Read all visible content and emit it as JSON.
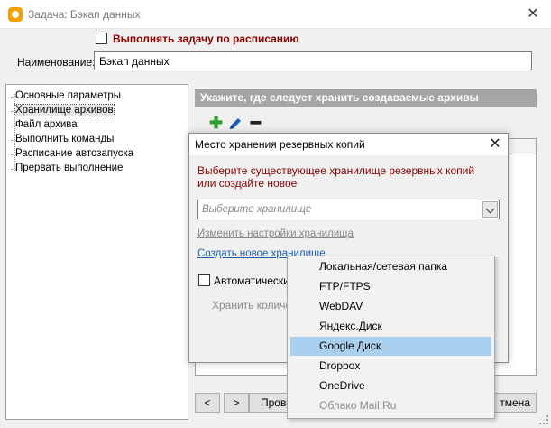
{
  "window": {
    "title": "Задача: Бэкап данных"
  },
  "schedule": {
    "label": "Выполнять задачу по расписанию",
    "checked": false
  },
  "name_field": {
    "label": "Наименование:",
    "value": "Бэкап данных"
  },
  "tree": {
    "items": [
      {
        "label": "Основные параметры"
      },
      {
        "label": "Хранилище архивов",
        "selected": true
      },
      {
        "label": "Файл архива"
      },
      {
        "label": "Выполнить команды"
      },
      {
        "label": "Расписание автозапуска"
      },
      {
        "label": "Прервать выполнение"
      }
    ]
  },
  "panel": {
    "header": "Укажите, где следует хранить создаваемые архивы",
    "toolbar": {
      "add_icon": "plus-icon",
      "edit_icon": "pencil-icon",
      "remove_icon": "minus-icon"
    }
  },
  "footer": {
    "prev_label": "<",
    "next_label": ">",
    "check_label": "Прове",
    "cancel_label": "тмена"
  },
  "dialog": {
    "title": "Место хранения резервных копий",
    "prompt": "Выберите существующее хранилище резервных копий или создайте новое",
    "combo_placeholder": "Выберите хранилище",
    "edit_link": "Изменить настройки хранилища",
    "create_link": "Создать новое хранилище",
    "auto_label": "Автоматически у",
    "keep_label": "Хранить количе"
  },
  "menu": {
    "items": [
      {
        "label": "Локальная/сетевая папка"
      },
      {
        "label": "FTP/FTPS"
      },
      {
        "label": "WebDAV"
      },
      {
        "label": "Яндекс.Диск"
      },
      {
        "label": "Google Диск",
        "highlighted": true
      },
      {
        "label": "Dropbox"
      },
      {
        "label": "OneDrive"
      },
      {
        "label": "Облако Mail.Ru",
        "disabled": true
      }
    ]
  },
  "colors": {
    "accent_red": "#8b0000",
    "link_blue": "#1a5fb4",
    "highlight": "#aad0f0",
    "header_gray": "#a5a5a5",
    "add_green": "#2f9e2f"
  }
}
